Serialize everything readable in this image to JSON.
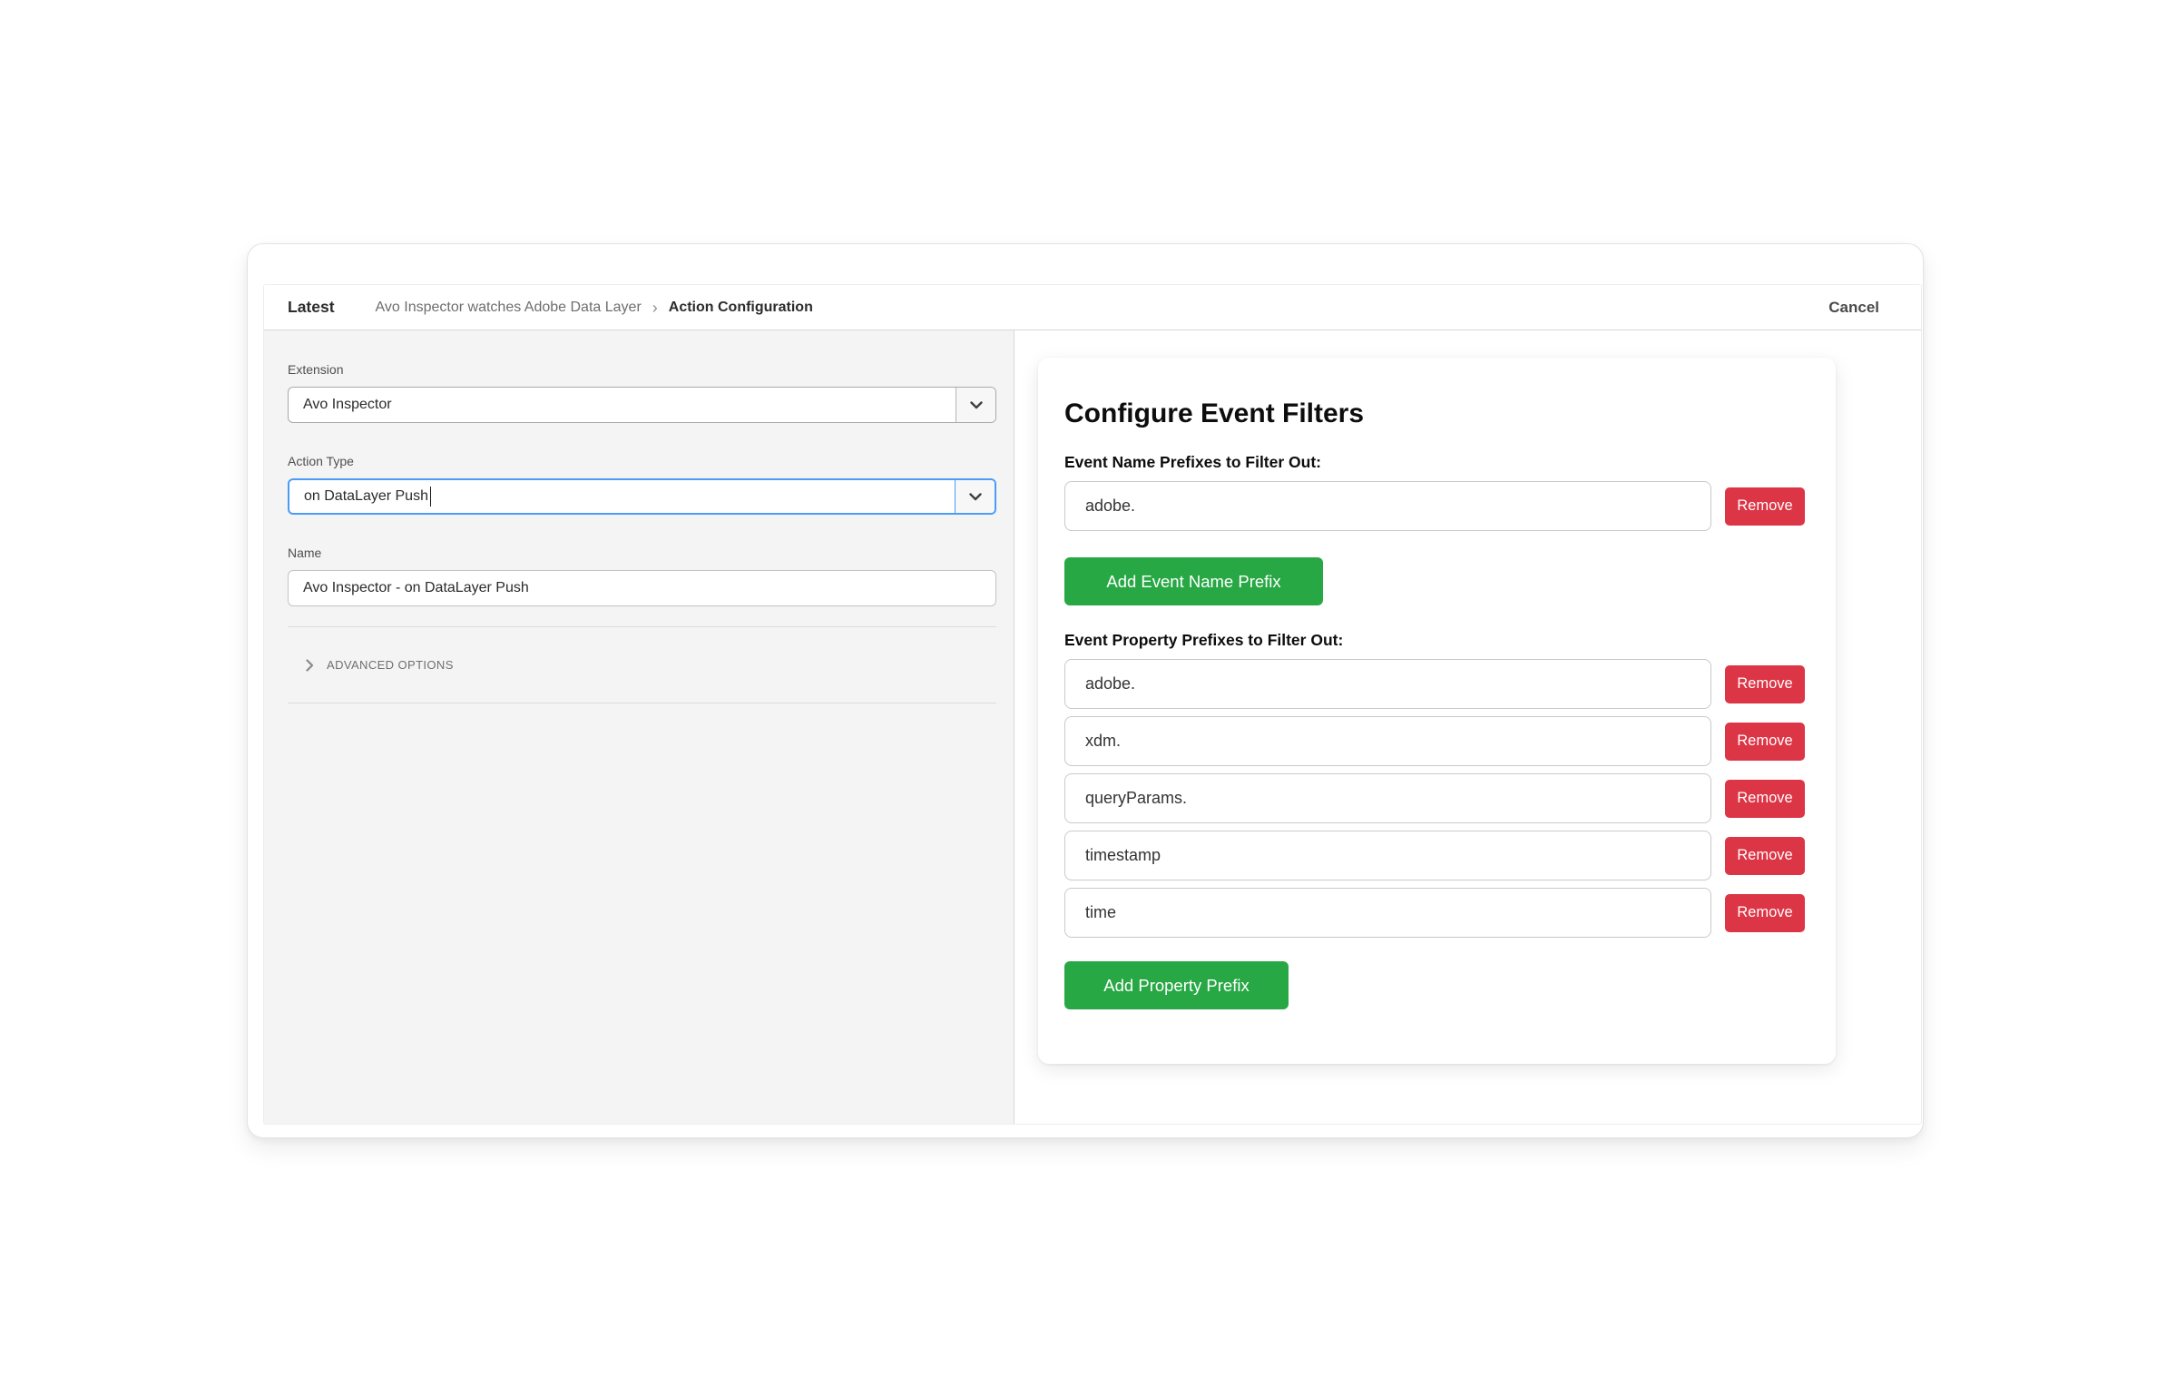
{
  "window": {
    "breadcrumb": {
      "version": "Latest",
      "rule": "Avo Inspector watches Adobe Data Layer",
      "separator": "›",
      "current": "Action Configuration"
    },
    "cancel_label": "Cancel"
  },
  "left_panel": {
    "extension": {
      "label": "Extension",
      "value": "Avo Inspector"
    },
    "action_type": {
      "label": "Action Type",
      "value": "on DataLayer Push"
    },
    "name": {
      "label": "Name",
      "value": "Avo Inspector - on DataLayer Push"
    },
    "advanced_options_label": "ADVANCED OPTIONS"
  },
  "right_panel": {
    "title": "Configure Event Filters",
    "remove_button_label": "Remove",
    "event_name_section": {
      "label": "Event Name Prefixes to Filter Out:",
      "prefixes": [
        {
          "value": "adobe."
        }
      ],
      "add_button_label": "Add Event Name Prefix"
    },
    "event_property_section": {
      "label": "Event Property Prefixes to Filter Out:",
      "prefixes": [
        {
          "value": "adobe."
        },
        {
          "value": "xdm."
        },
        {
          "value": "queryParams."
        },
        {
          "value": "timestamp"
        },
        {
          "value": "time"
        }
      ],
      "add_button_label": "Add Property Prefix"
    }
  },
  "colors": {
    "add_button_green": "#28a745",
    "remove_button_red": "#dc3545",
    "focus_blue": "#4b9cf7",
    "left_panel_gray": "#f4f4f4"
  }
}
